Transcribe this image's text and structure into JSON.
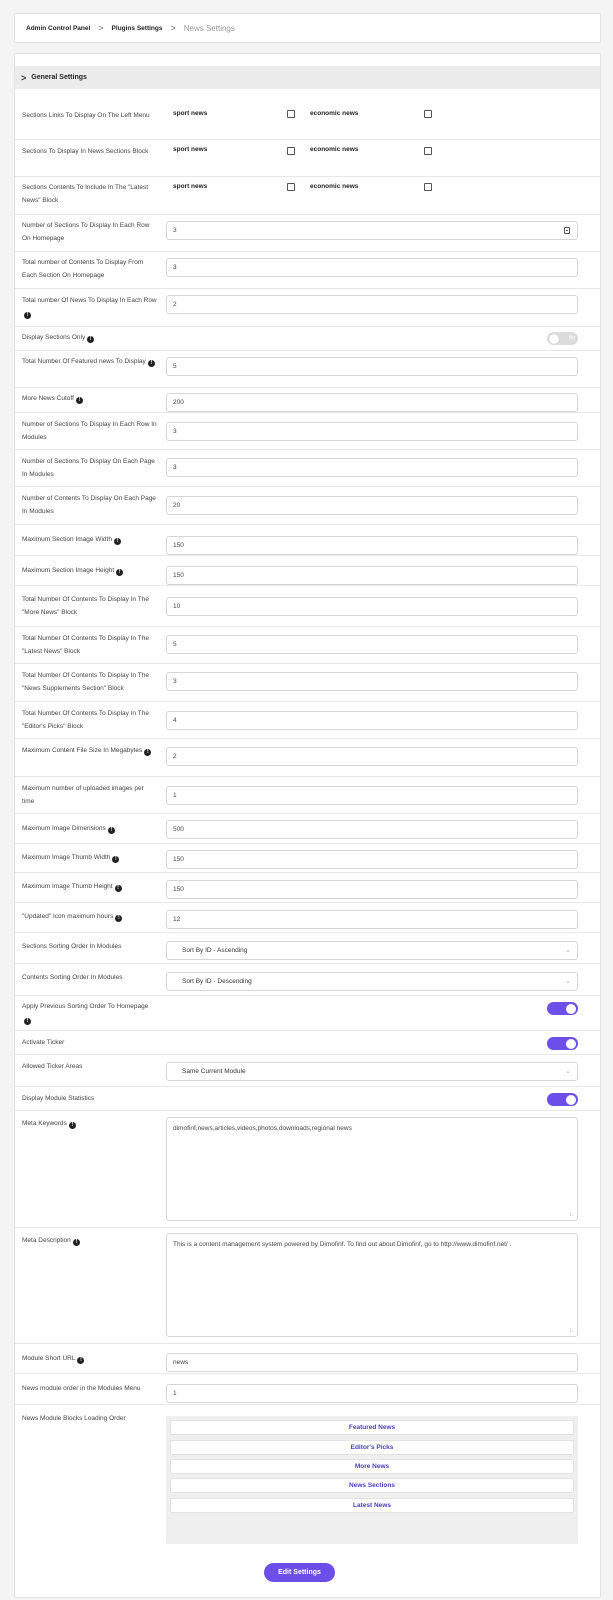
{
  "breadcrumb": {
    "items": [
      "Admin Control Panel",
      "Plugins Settings",
      "News Settings"
    ],
    "separator": ">"
  },
  "section": {
    "title": "General Settings",
    "chevron": ">"
  },
  "checkbox_rows": [
    {
      "label": "Sections Links To Display On The Left Menu",
      "options": [
        "sport news",
        "economic news"
      ]
    },
    {
      "label": "Sections To Display In News Sections Block",
      "options": [
        "sport news",
        "economic news"
      ]
    },
    {
      "label": "Sections Contents To Include In The \"Latest News\" Block",
      "options": [
        "sport news",
        "economic news"
      ]
    }
  ],
  "fields": {
    "sections_per_row_home": {
      "label": "Number of Sections To Display In Each Row On Homepage",
      "value": "3"
    },
    "contents_per_section_home": {
      "label": "Total number of Contents To Display From Each Section On Homepage",
      "value": "3"
    },
    "news_per_row": {
      "label": "Total number Of News To Display In Each Row",
      "value": "2"
    },
    "display_sections_only": {
      "label": "Display Sections Only",
      "toggle_text": "No"
    },
    "featured_news": {
      "label": "Total Number Of Featured news To Display",
      "value": "5"
    },
    "more_news_cutoff": {
      "label": "More News Cutoff",
      "value": "200"
    },
    "sections_per_row_modules": {
      "label": "Number of Sections To Display In Each Row In Modules",
      "value": "3"
    },
    "sections_per_page_modules": {
      "label": "Number of Sections To Display On Each Page In Modules",
      "value": "3"
    },
    "contents_per_page_modules": {
      "label": "Number of Contents To Display On Each Page In Modules",
      "value": "20"
    },
    "max_section_img_width": {
      "label": "Maximum Section Image Width",
      "value": "150"
    },
    "max_section_img_height": {
      "label": "Maximum Section Image Height",
      "value": "150"
    },
    "more_news_block": {
      "label": "Total Number Of Contents To Display In The \"More News\" Block",
      "value": "10"
    },
    "latest_news_block": {
      "label": "Total Number Of Contents To Display In The \"Latest News\" Block",
      "value": "5"
    },
    "supplements_block": {
      "label": "Total Number Of Contents To Display In The \"News Supplements Section\" Block",
      "value": "3"
    },
    "editors_picks_block": {
      "label": "Total Number Of Contents To Display In The \"Editor's Picks\" Block",
      "value": "4"
    },
    "max_file_size": {
      "label": "Maximum Content File Size In Megabytes",
      "value": "2"
    },
    "max_uploaded_images": {
      "label": "Maximum number of uploaded images per time",
      "value": "1"
    },
    "max_image_dimensions": {
      "label": "Maximum Image Dimensions",
      "value": "500"
    },
    "max_thumb_width": {
      "label": "Maximum Image Thumb Width",
      "value": "150"
    },
    "max_thumb_height": {
      "label": "Maximum Image Thumb Height",
      "value": "150"
    },
    "updated_icon_hours": {
      "label": "\"Updated\" Icon maximum hours",
      "value": "12"
    },
    "sections_sort": {
      "label": "Sections Sorting Order In Modules",
      "value": "Sort By ID - Ascending"
    },
    "contents_sort": {
      "label": "Contents Sorting Order In Modules",
      "value": "Sort By ID - Descending"
    },
    "apply_prev_sort": {
      "label": "Apply Previous Sorting Order To Homepage"
    },
    "activate_ticker": {
      "label": "Activate Ticker"
    },
    "ticker_areas": {
      "label": "Allowed Ticker Areas",
      "value": "Same Current Module"
    },
    "module_statistics": {
      "label": "Display Module Statistics"
    },
    "meta_keywords": {
      "label": "Meta Keywords",
      "value": "dimofinf,news,articles,videos,photos,downloads,regional news"
    },
    "meta_description": {
      "label": "Meta Description",
      "value": "This is a content management system powered by Dimofinf. To find out about Dimofinf, go to http://www.dimofinf.net/ ."
    },
    "module_short_url": {
      "label": "Module Short URL",
      "value": "news"
    },
    "module_order": {
      "label": "News module order in the Modules Menu",
      "value": "1"
    },
    "blocks_loading_order": {
      "label": "News Module Blocks Loading Order",
      "items": [
        "Featured News",
        "Editor's Picks",
        "More News",
        "News Sections",
        "Latest News"
      ]
    }
  },
  "toggles": {
    "display_sections_only": false,
    "apply_prev_sort": true,
    "activate_ticker": true,
    "module_statistics": true
  },
  "submit_label": "Edit Settings",
  "colors": {
    "accent": "#6c4fe8",
    "section_header_bg": "#ececec",
    "page_bg": "#f4f4f5"
  },
  "icons": {
    "info": "info-circle-icon",
    "dropdown": "chevron-down-icon",
    "spinner": "number-stepper-icon"
  }
}
